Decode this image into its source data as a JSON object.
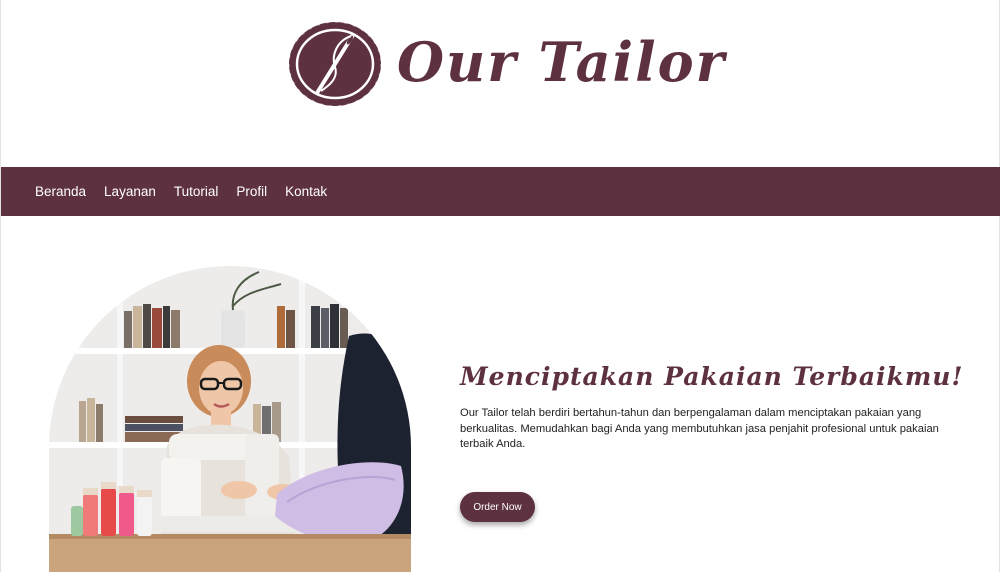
{
  "brand": {
    "name": "Our Tailor",
    "logo_icon": "needle-thread-icon",
    "color": "#5e3140"
  },
  "nav": {
    "items": [
      {
        "label": "Beranda"
      },
      {
        "label": "Layanan"
      },
      {
        "label": "Tutorial"
      },
      {
        "label": "Profil"
      },
      {
        "label": "Kontak"
      }
    ]
  },
  "hero": {
    "title": "Menciptakan Pakaian Terbaikmu!",
    "description": "Our Tailor telah berdiri bertahun-tahun dan berpengalaman dalam menciptakan pakaian yang berkualitas. Memudahkan bagi Anda yang membutuhkan jasa penjahit profesional untuk pakaian terbaik Anda.",
    "button_label": "Order Now",
    "image": "woman-sewing-machine-photo"
  }
}
